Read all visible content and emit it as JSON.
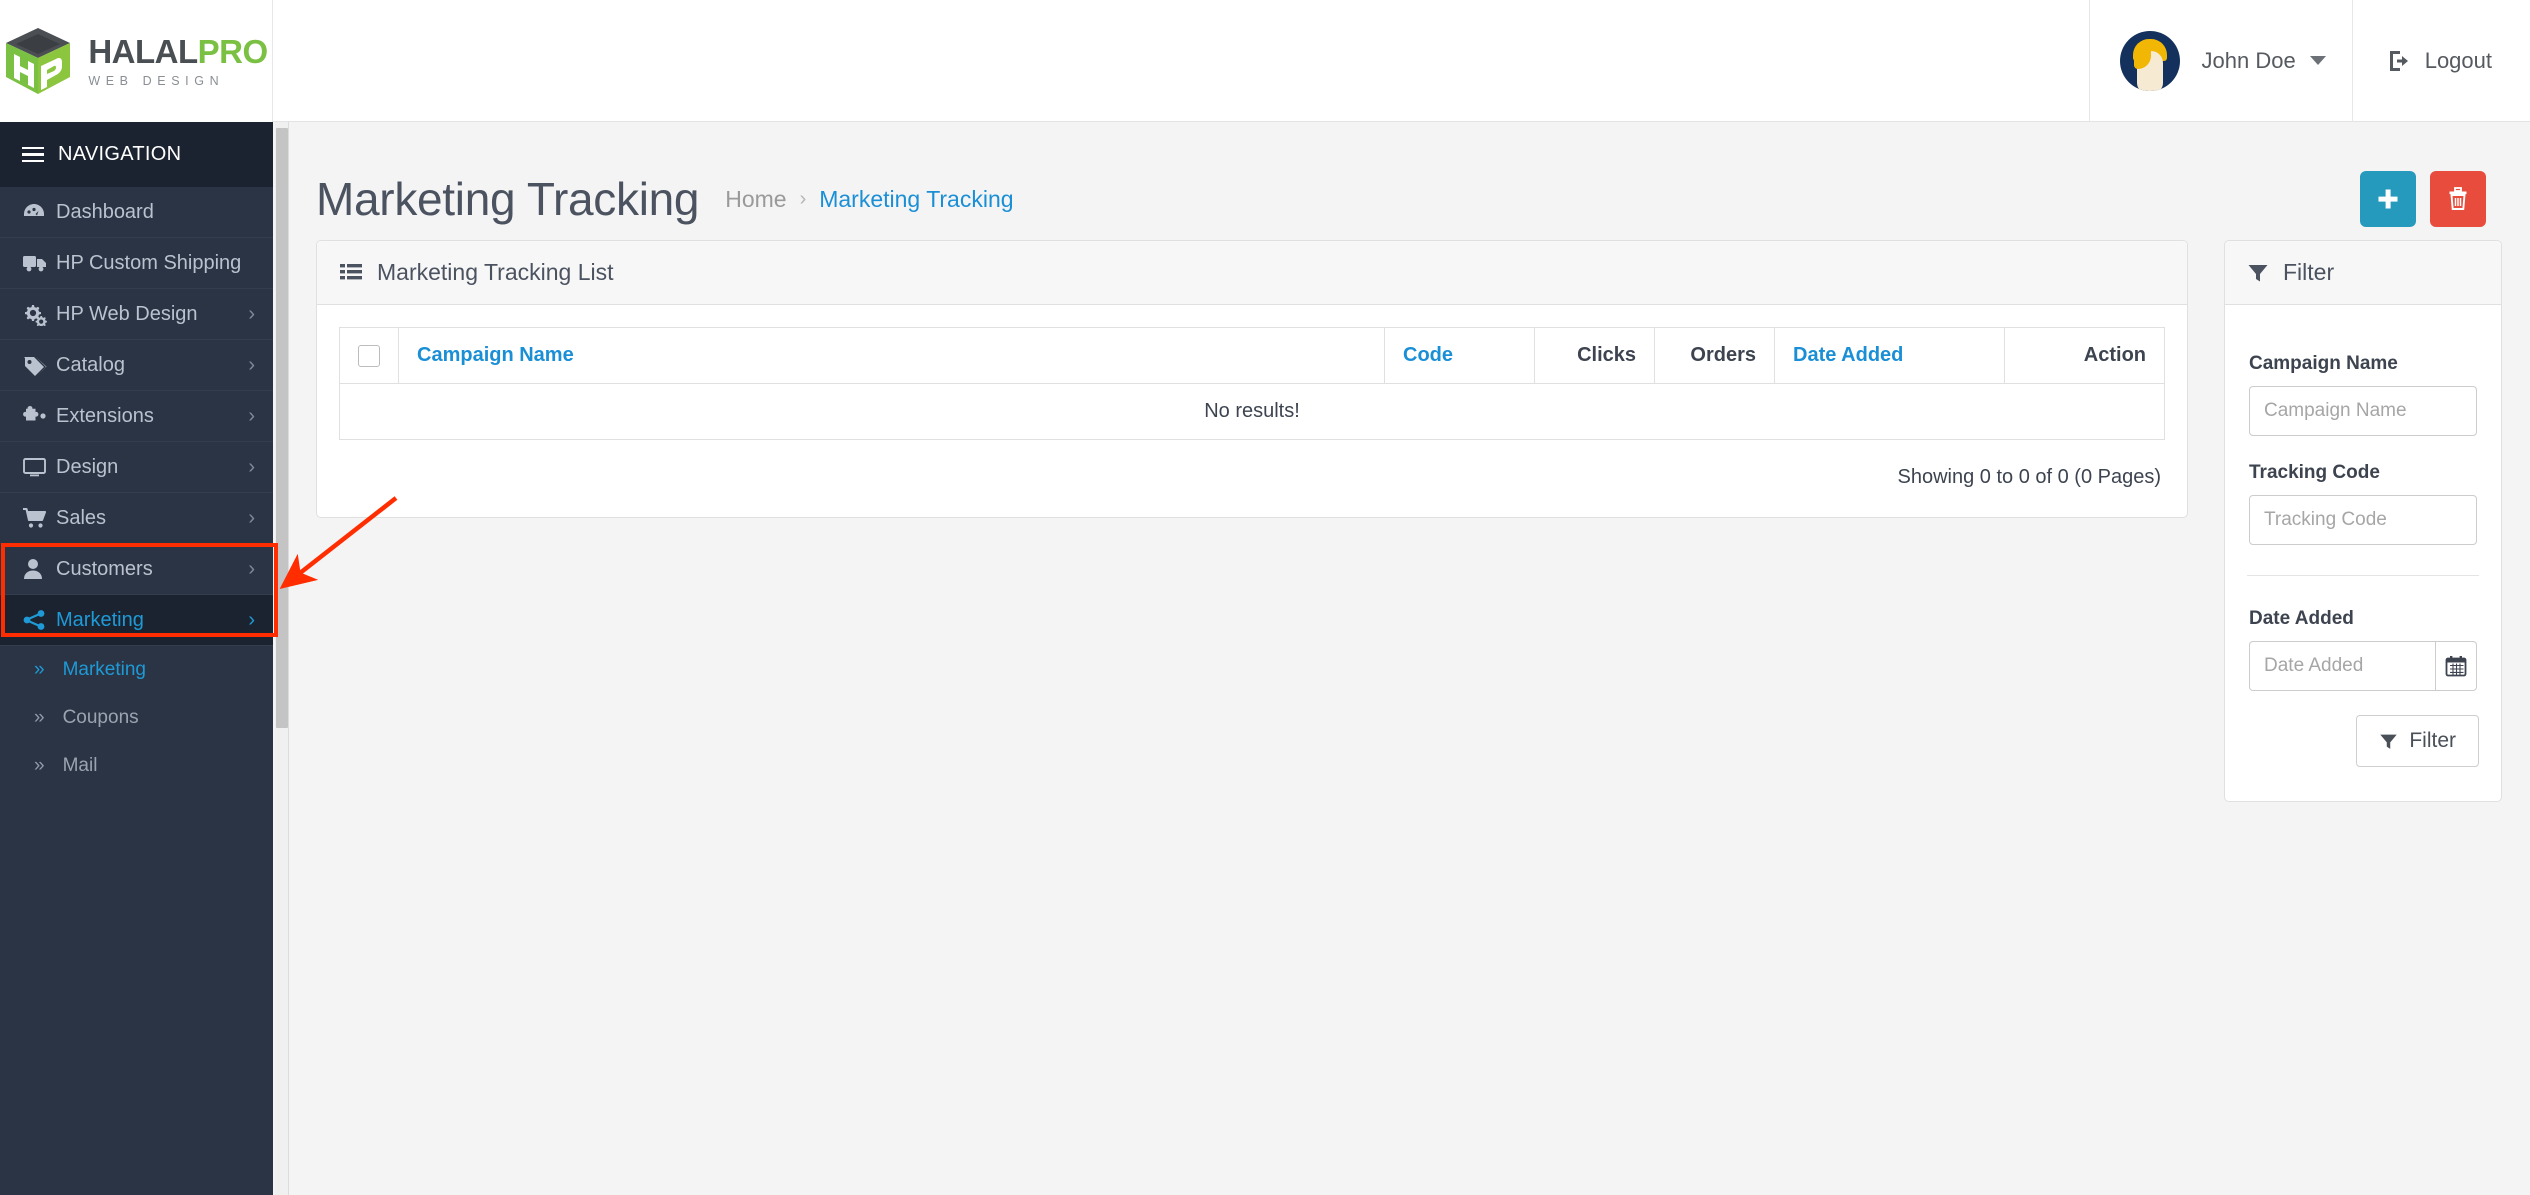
{
  "brand": {
    "name_primary": "HALAL",
    "name_secondary": "PRO",
    "tagline": "WEB DESIGN",
    "logo_icon": "hp-cube-logo"
  },
  "topbar": {
    "user_name": "John Doe",
    "user_caret_icon": "chevron-down-icon",
    "avatar_icon": "user-avatar",
    "logout_label": "Logout",
    "logout_icon": "sign-out-icon"
  },
  "sidebar": {
    "header_label": "NAVIGATION",
    "header_icon": "hamburger-icon",
    "items": [
      {
        "label": "Dashboard",
        "icon": "dashboard-icon",
        "arrow": "",
        "active": false
      },
      {
        "label": "HP Custom Shipping",
        "icon": "truck-icon",
        "arrow": "",
        "active": false
      },
      {
        "label": "HP Web Design",
        "icon": "gears-icon",
        "arrow": "›",
        "active": false
      },
      {
        "label": "Catalog",
        "icon": "tag-icon",
        "arrow": "›",
        "active": false
      },
      {
        "label": "Extensions",
        "icon": "puzzle-icon",
        "arrow": "›",
        "active": false
      },
      {
        "label": "Design",
        "icon": "monitor-icon",
        "arrow": "›",
        "active": false
      },
      {
        "label": "Sales",
        "icon": "cart-icon",
        "arrow": "›",
        "active": false
      },
      {
        "label": "Customers",
        "icon": "user-icon",
        "arrow": "›",
        "active": false
      },
      {
        "label": "Marketing",
        "icon": "share-alt-icon",
        "arrow": "›",
        "active": true
      }
    ],
    "subitems": [
      {
        "label": "Marketing",
        "icon": "double-chevron-right-icon",
        "selected": true
      },
      {
        "label": "Coupons",
        "icon": "double-chevron-right-icon",
        "selected": false
      },
      {
        "label": "Mail",
        "icon": "double-chevron-right-icon",
        "selected": false
      }
    ]
  },
  "page": {
    "title": "Marketing Tracking",
    "breadcrumb": {
      "home": "Home",
      "separator": "›",
      "current": "Marketing Tracking"
    },
    "actions": {
      "add_icon": "plus-icon",
      "delete_icon": "trash-icon",
      "add_color": "#269abc",
      "delete_color": "#e74c3c"
    }
  },
  "list_panel": {
    "title": "Marketing Tracking List",
    "title_icon": "list-icon",
    "columns": [
      {
        "key": "select",
        "label": "",
        "type": "checkbox"
      },
      {
        "key": "campaign_name",
        "label": "Campaign Name",
        "sortable": true
      },
      {
        "key": "code",
        "label": "Code",
        "sortable": true
      },
      {
        "key": "clicks",
        "label": "Clicks",
        "sortable": false
      },
      {
        "key": "orders",
        "label": "Orders",
        "sortable": false
      },
      {
        "key": "date_added",
        "label": "Date Added",
        "sortable": true
      },
      {
        "key": "action",
        "label": "Action",
        "sortable": false
      }
    ],
    "rows": [],
    "empty_message": "No results!",
    "showing_text": "Showing 0 to 0 of 0 (0 Pages)"
  },
  "filter_panel": {
    "title": "Filter",
    "title_icon": "funnel-icon",
    "fields": [
      {
        "label": "Campaign Name",
        "placeholder": "Campaign Name",
        "value": "",
        "name": "campaign-name"
      },
      {
        "label": "Tracking Code",
        "placeholder": "Tracking Code",
        "value": "",
        "name": "tracking-code"
      },
      {
        "label": "Date Added",
        "placeholder": "Date Added",
        "value": "",
        "name": "date-added",
        "addon_icon": "calendar-icon"
      }
    ],
    "button_label": "Filter",
    "button_icon": "funnel-icon"
  },
  "annotation": {
    "highlight_color": "#ff2d00",
    "arrow_color": "#ff2d00",
    "target": "Marketing"
  }
}
